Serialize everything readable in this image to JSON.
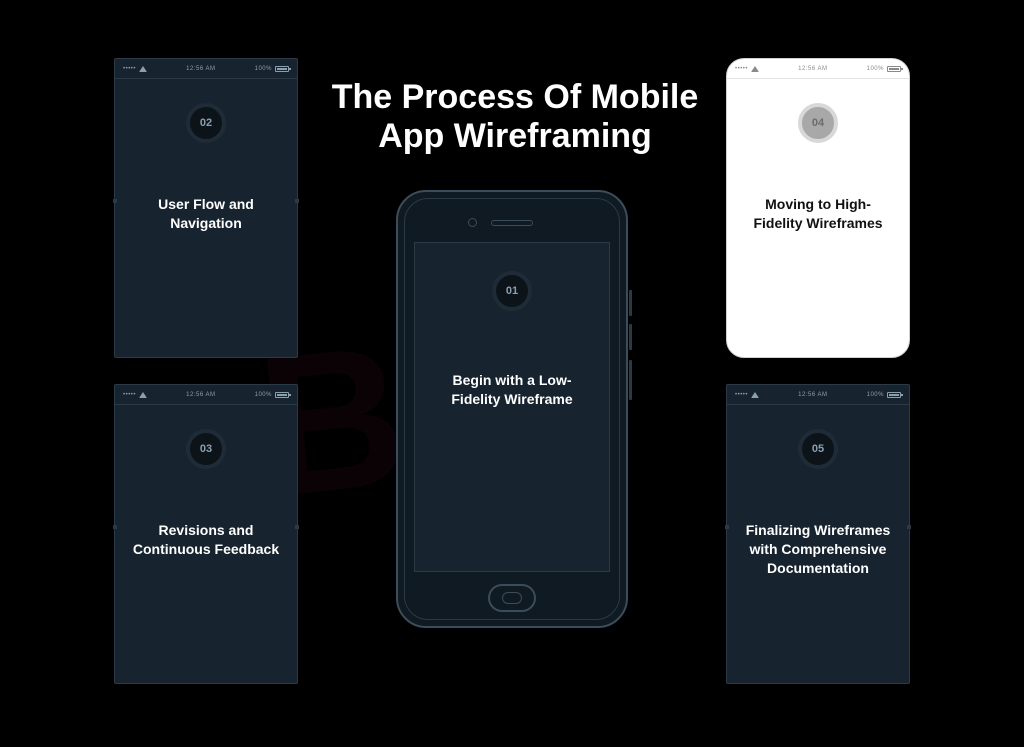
{
  "title": "The Process Of Mobile App Wireframing",
  "status": {
    "time": "12:56 AM",
    "battery_pct": "100%"
  },
  "steps": {
    "s1": {
      "num": "01",
      "label": "Begin with a Low-Fidelity Wireframe"
    },
    "s2": {
      "num": "02",
      "label": "User Flow and Navigation"
    },
    "s3": {
      "num": "03",
      "label": "Revisions and Continuous Feedback"
    },
    "s4": {
      "num": "04",
      "label": "Moving to High-Fidelity Wireframes"
    },
    "s5": {
      "num": "05",
      "label": "Finalizing Wireframes with Comprehensive Documentation"
    }
  }
}
